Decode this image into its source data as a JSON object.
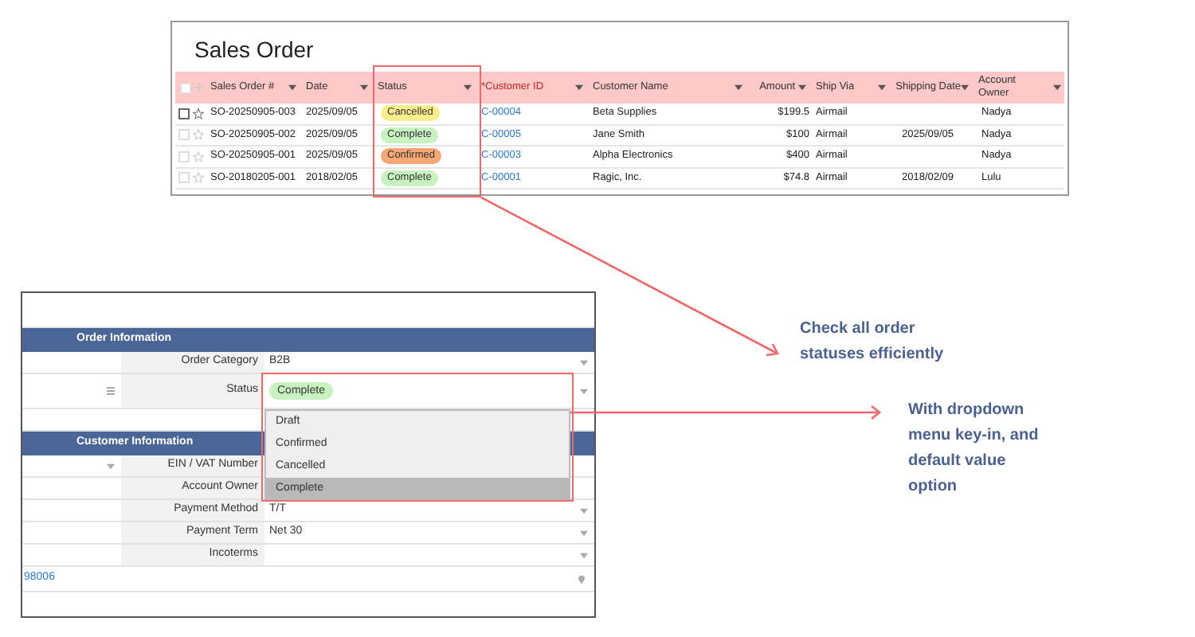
{
  "sales_order_list": {
    "title": "Sales Order",
    "columns": [
      {
        "label": "Sales Order #",
        "required": false
      },
      {
        "label": "Date",
        "required": false
      },
      {
        "label": "Status",
        "required": false
      },
      {
        "label": "*Customer ID",
        "required": true
      },
      {
        "label": "Customer Name",
        "required": false
      },
      {
        "label": "Amount",
        "required": false
      },
      {
        "label": "Ship Via",
        "required": false
      },
      {
        "label": "Shipping Date",
        "required": false
      },
      {
        "label": "Account Owner",
        "required": false
      }
    ],
    "select_all_checked": false,
    "rows": [
      {
        "checked": false,
        "sales_order_no": "SO-20250905-003",
        "date": "2025/09/05",
        "status": {
          "label": "Cancelled",
          "color": "#fbee8f"
        },
        "customer_id": "C-00004",
        "customer_name": "Beta Supplies",
        "amount": "$199.5",
        "ship_via": "Airmail",
        "shipping_date": "",
        "account_owner": "Nadya"
      },
      {
        "checked": false,
        "sales_order_no": "SO-20250905-002",
        "date": "2025/09/05",
        "status": {
          "label": "Complete",
          "color": "#c8f2c0"
        },
        "customer_id": "C-00005",
        "customer_name": "Jane Smith",
        "amount": "$100",
        "ship_via": "Airmail",
        "shipping_date": "2025/09/05",
        "account_owner": "Nadya"
      },
      {
        "checked": false,
        "sales_order_no": "SO-20250905-001",
        "date": "2025/09/05",
        "status": {
          "label": "Confirmed",
          "color": "#f7a774"
        },
        "customer_id": "C-00003",
        "customer_name": "Alpha Electronics",
        "amount": "$400",
        "ship_via": "Airmail",
        "shipping_date": "",
        "account_owner": "Nadya"
      },
      {
        "checked": false,
        "sales_order_no": "SO-20180205-001",
        "date": "2018/02/05",
        "status": {
          "label": "Complete",
          "color": "#c8f2c0"
        },
        "customer_id": "C-00001",
        "customer_name": "Ragic, Inc.",
        "amount": "$74.8",
        "ship_via": "Airmail",
        "shipping_date": "2018/02/09",
        "account_owner": "Lulu"
      }
    ]
  },
  "order_form": {
    "rows": [
      {
        "kind": "spacer"
      },
      {
        "kind": "section",
        "title": "Order Information"
      },
      {
        "kind": "field",
        "label": "Order Category",
        "value": "B2B",
        "dropdown": true
      },
      {
        "kind": "status",
        "label": "Status",
        "badge": {
          "label": "Complete",
          "color": "#c8f2c0"
        },
        "dropdown": true
      },
      {
        "kind": "blank"
      },
      {
        "kind": "section",
        "title": "Customer Information"
      },
      {
        "kind": "field",
        "label": "EIN / VAT Number",
        "value": "",
        "dropdown": false,
        "left_caret": true
      },
      {
        "kind": "field",
        "label": "Account Owner",
        "value": "",
        "dropdown": false
      },
      {
        "kind": "field",
        "label": "Payment Method",
        "value": "T/T",
        "dropdown": true
      },
      {
        "kind": "field",
        "label": "Payment Term",
        "value": "Net 30",
        "dropdown": true
      },
      {
        "kind": "field",
        "label": "Incoterms",
        "value": "",
        "dropdown": true
      },
      {
        "kind": "link",
        "value": "98006"
      }
    ],
    "status_menu": [
      {
        "label": "Draft",
        "selected": false
      },
      {
        "label": "Confirmed",
        "selected": false
      },
      {
        "label": "Cancelled",
        "selected": false
      },
      {
        "label": "Complete",
        "selected": true
      }
    ]
  },
  "callouts": [
    "Check all order statuses efficiently",
    "With dropdown menu key-in, and default value option"
  ]
}
